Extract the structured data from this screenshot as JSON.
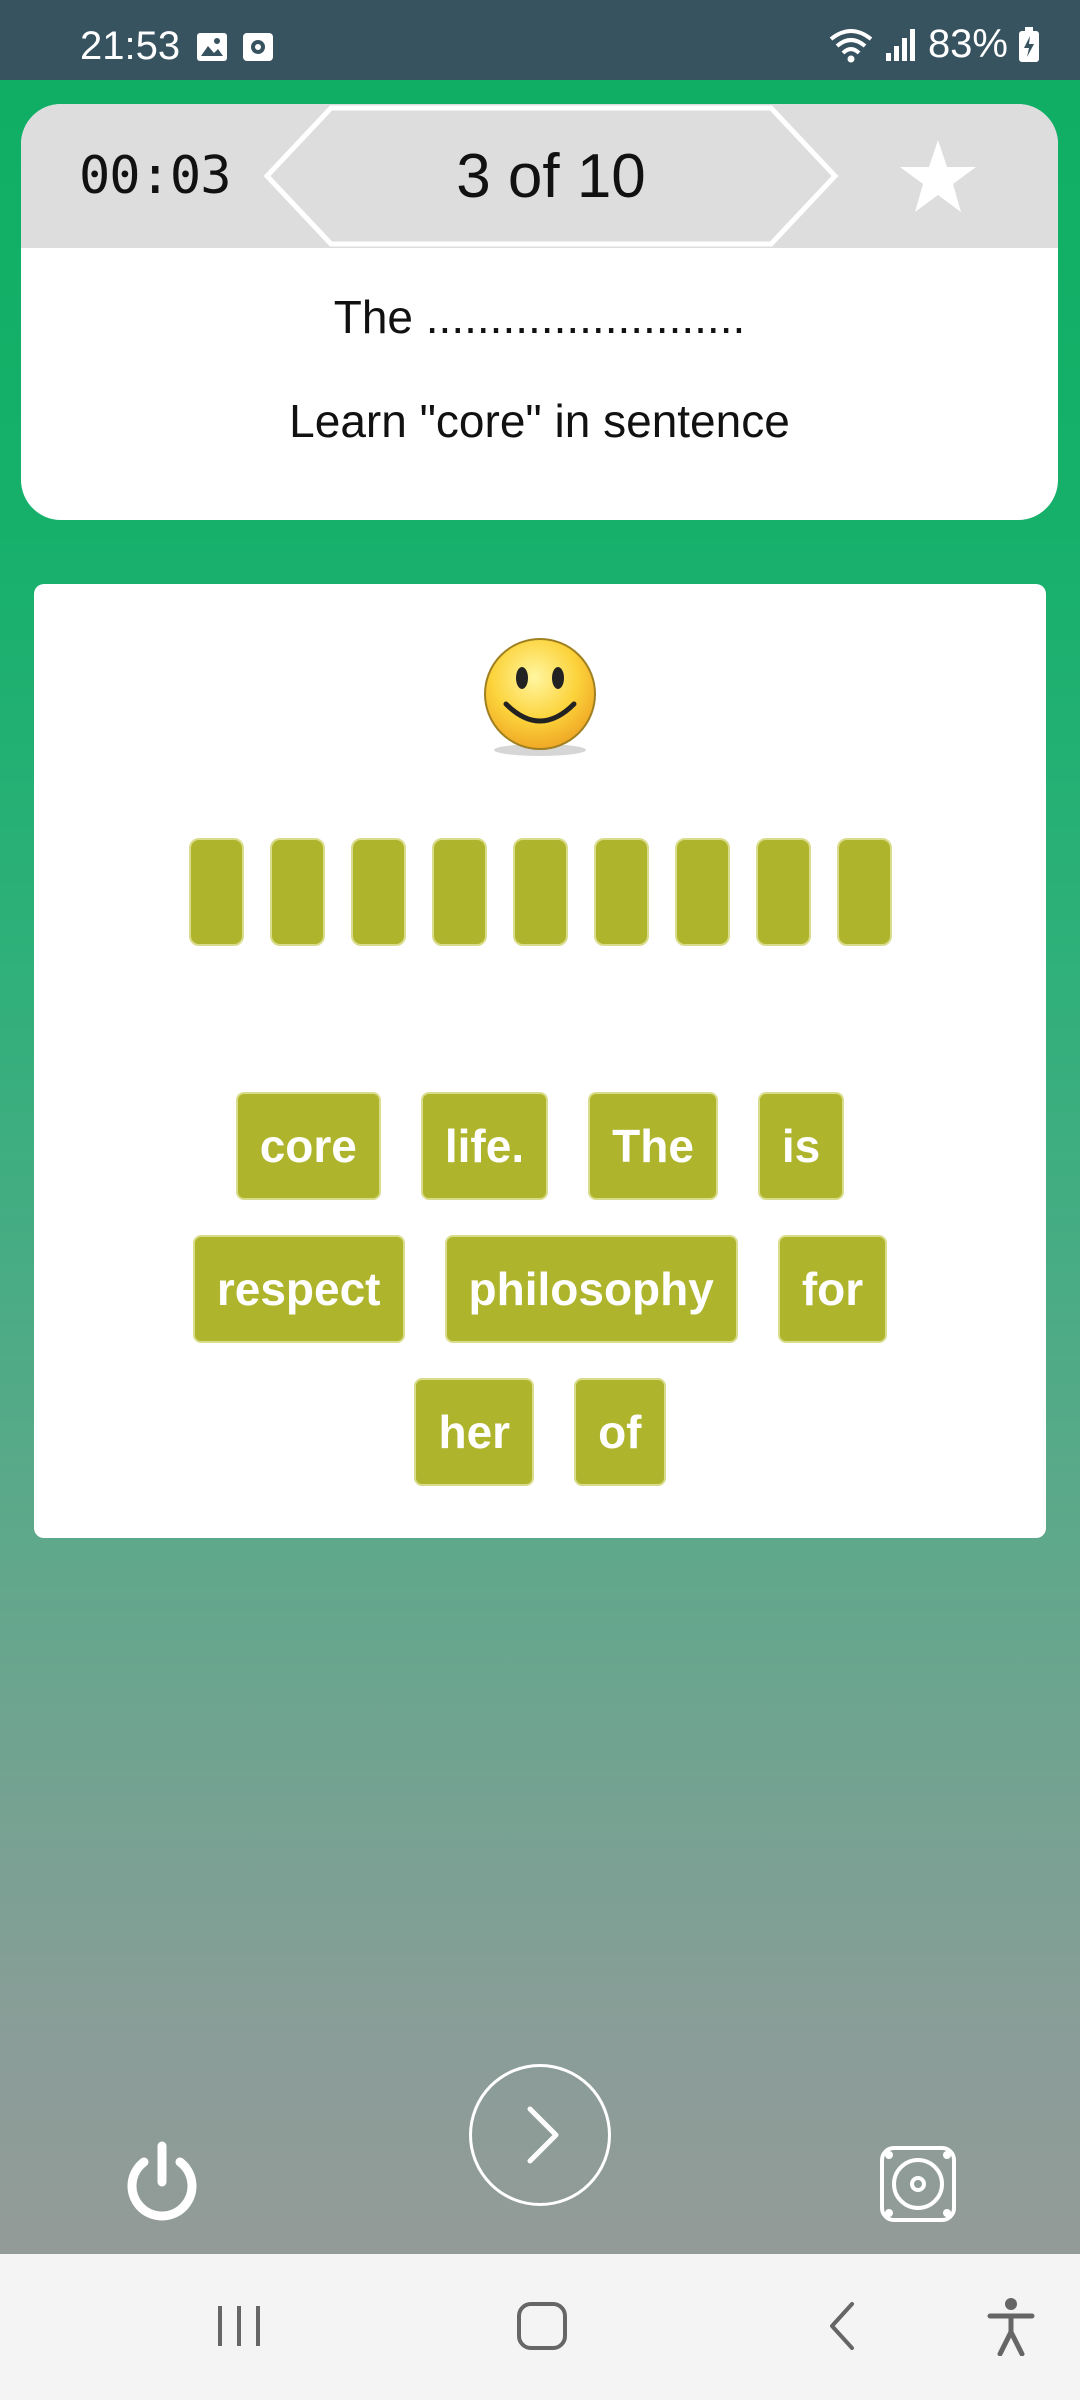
{
  "status_bar": {
    "time": "21:53",
    "battery": "83%"
  },
  "header": {
    "timer": "00:03",
    "progress": "3 of 10",
    "sentence_blank": "The .........................",
    "instruction": "Learn \"core\" in sentence"
  },
  "puzzle": {
    "slot_count": 9,
    "word_rows": [
      [
        "core",
        "life.",
        "The",
        "is"
      ],
      [
        "respect",
        "philosophy",
        "for"
      ],
      [
        "her",
        "of"
      ]
    ]
  },
  "colors": {
    "tile": "#afb42d",
    "status_bar": "#37535f",
    "header_bg": "#dddddd"
  },
  "icons": {
    "next": "chevron-right-icon",
    "power": "power-icon",
    "sound": "speaker-icon",
    "favorite": "star-icon",
    "feedback": "smiley-icon"
  }
}
